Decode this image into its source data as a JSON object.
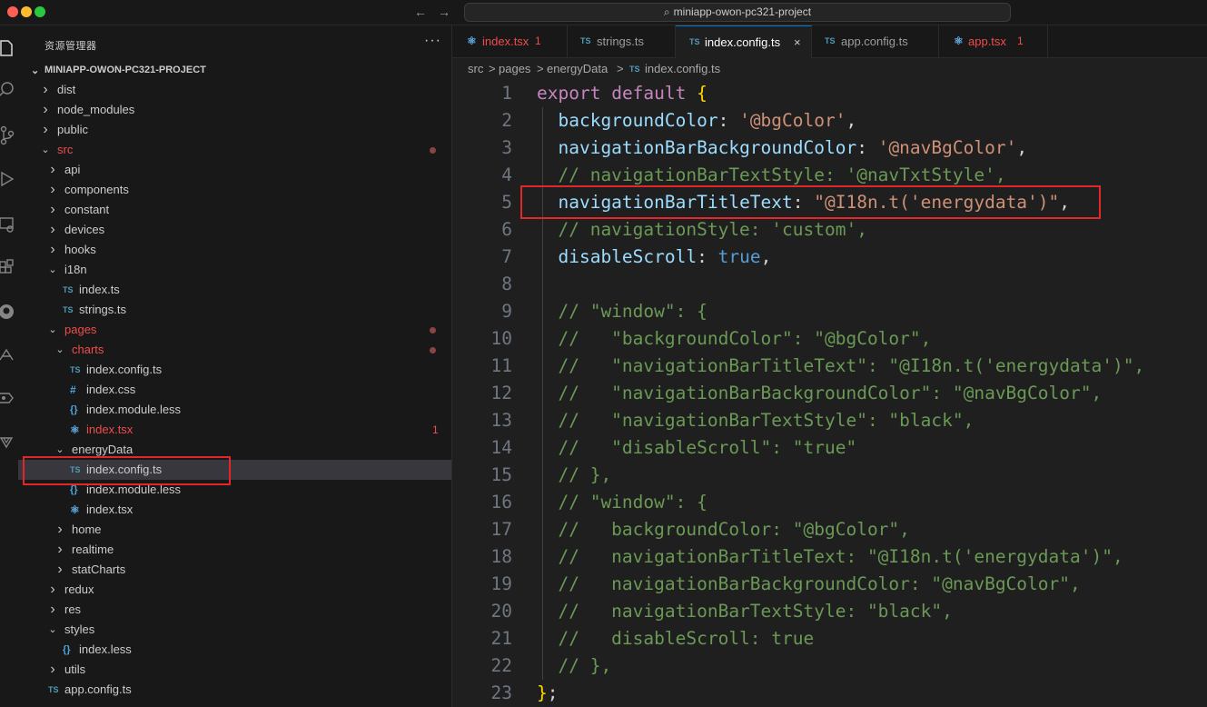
{
  "titlebar": {
    "search_text": "miniapp-owon-pc321-project",
    "back_icon": "arrow-left-icon",
    "forward_icon": "arrow-right-icon"
  },
  "activity_bar": {
    "icons": [
      "files-icon",
      "search-icon",
      "source-control-icon",
      "run-debug-icon",
      "remote-explorer-icon",
      "extensions-icon",
      "github-icon",
      "deploy-icon",
      "git-graph-icon",
      "extension-tool-icon"
    ]
  },
  "sidebar": {
    "title": "资源管理器",
    "more": "···",
    "project": "MINIAPP-OWON-PC321-PROJECT",
    "rows": [
      {
        "label": "dist",
        "kind": "folder",
        "open": false,
        "depth": 0
      },
      {
        "label": "node_modules",
        "kind": "folder",
        "open": false,
        "depth": 0
      },
      {
        "label": "public",
        "kind": "folder",
        "open": false,
        "depth": 0
      },
      {
        "label": "src",
        "kind": "folder",
        "open": true,
        "depth": 0,
        "red": true,
        "dot": true
      },
      {
        "label": "api",
        "kind": "folder",
        "open": false,
        "depth": 1
      },
      {
        "label": "components",
        "kind": "folder",
        "open": false,
        "depth": 1
      },
      {
        "label": "constant",
        "kind": "folder",
        "open": false,
        "depth": 1
      },
      {
        "label": "devices",
        "kind": "folder",
        "open": false,
        "depth": 1
      },
      {
        "label": "hooks",
        "kind": "folder",
        "open": false,
        "depth": 1
      },
      {
        "label": "i18n",
        "kind": "folder",
        "open": true,
        "depth": 1
      },
      {
        "label": "index.ts",
        "kind": "ts",
        "depth": 2
      },
      {
        "label": "strings.ts",
        "kind": "ts",
        "depth": 2
      },
      {
        "label": "pages",
        "kind": "folder",
        "open": true,
        "depth": 1,
        "red": true,
        "dot": true
      },
      {
        "label": "charts",
        "kind": "folder",
        "open": true,
        "depth": 2,
        "red": true,
        "dot": true
      },
      {
        "label": "index.config.ts",
        "kind": "ts",
        "depth": 3
      },
      {
        "label": "index.css",
        "kind": "css",
        "depth": 3
      },
      {
        "label": "index.module.less",
        "kind": "less",
        "depth": 3
      },
      {
        "label": "index.tsx",
        "kind": "tsx",
        "depth": 3,
        "red": true,
        "count": "1"
      },
      {
        "label": "energyData",
        "kind": "folder",
        "open": true,
        "depth": 2
      },
      {
        "label": "index.config.ts",
        "kind": "ts",
        "depth": 3,
        "selected": true
      },
      {
        "label": "index.module.less",
        "kind": "less",
        "depth": 3
      },
      {
        "label": "index.tsx",
        "kind": "tsx",
        "depth": 3
      },
      {
        "label": "home",
        "kind": "folder",
        "open": false,
        "depth": 2
      },
      {
        "label": "realtime",
        "kind": "folder",
        "open": false,
        "depth": 2
      },
      {
        "label": "statCharts",
        "kind": "folder",
        "open": false,
        "depth": 2
      },
      {
        "label": "redux",
        "kind": "folder",
        "open": false,
        "depth": 1
      },
      {
        "label": "res",
        "kind": "folder",
        "open": false,
        "depth": 1
      },
      {
        "label": "styles",
        "kind": "folder",
        "open": true,
        "depth": 1
      },
      {
        "label": "index.less",
        "kind": "less",
        "depth": 2
      },
      {
        "label": "utils",
        "kind": "folder",
        "open": false,
        "depth": 1
      },
      {
        "label": "app.config.ts",
        "kind": "ts",
        "depth": 0
      }
    ]
  },
  "tabs": [
    {
      "label": "index.tsx",
      "icon": "react",
      "count": "1",
      "red": true
    },
    {
      "label": "strings.ts",
      "icon": "ts"
    },
    {
      "label": "index.config.ts",
      "icon": "ts",
      "active": true,
      "close": "×"
    },
    {
      "label": "app.config.ts",
      "icon": "ts"
    },
    {
      "label": "app.tsx",
      "icon": "react",
      "count": "1",
      "red": true
    }
  ],
  "breadcrumb": {
    "items": [
      "src",
      "pages",
      "energyData",
      "index.config.ts"
    ],
    "separator": ">",
    "file_icon": "TS"
  },
  "editor": {
    "lines": [
      "1",
      "2",
      "3",
      "4",
      "5",
      "6",
      "7",
      "8",
      "9",
      "10",
      "11",
      "12",
      "13",
      "14",
      "15",
      "16",
      "17",
      "18",
      "19",
      "20",
      "21",
      "22",
      "23"
    ]
  },
  "colors": {
    "highlight_box": "#e0272a",
    "error_red": "#f14c4c",
    "accent": "#0078d4"
  }
}
